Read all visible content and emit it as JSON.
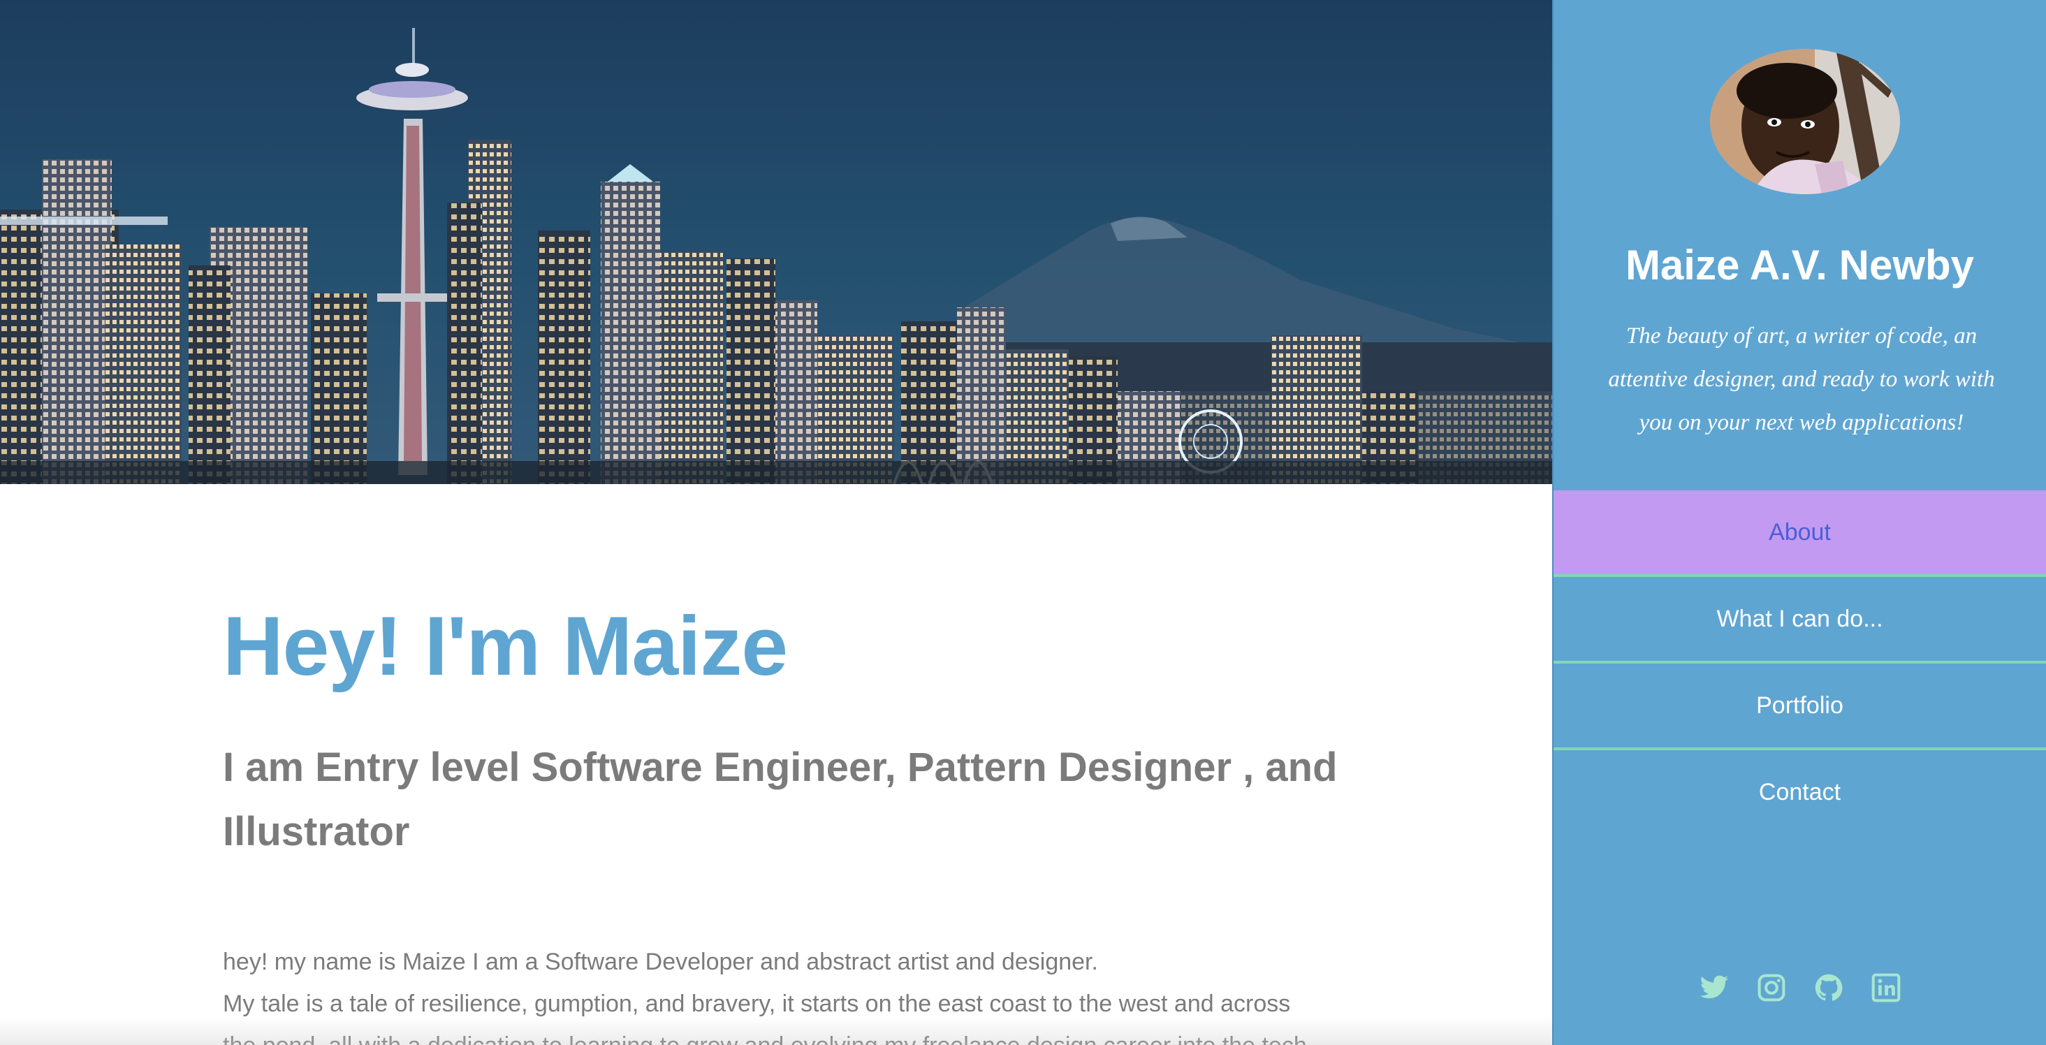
{
  "hero": {
    "image_alt": "Seattle skyline at night"
  },
  "main": {
    "headline": "Hey! I'm Maize",
    "subheadline": "I am Entry level Software Engineer, Pattern Designer , and Illustrator",
    "bio_lines": [
      "hey! my name is Maize I am a Software Developer and abstract artist and designer.",
      "My tale is a tale of resilience, gumption, and bravery, it starts on the east coast to the west and across the pond, all with a dedication to learning to grow and evolving my freelance design career into the tech"
    ]
  },
  "sidebar": {
    "name": "Maize A.V. Newby",
    "tagline": "The beauty of art, a writer of code, an attentive designer, and ready to work with you on your next web applications!",
    "nav": [
      {
        "label": "About",
        "active": true
      },
      {
        "label": "What I can do...",
        "active": false
      },
      {
        "label": "Portfolio",
        "active": false
      },
      {
        "label": "Contact",
        "active": false
      }
    ],
    "social_icons": [
      "twitter-icon",
      "instagram-icon",
      "github-icon",
      "linkedin-icon"
    ]
  },
  "colors": {
    "sidebar_bg": "#5fa5d2",
    "headline": "#5fa5d2",
    "body_text": "#7b7b7b",
    "nav_active_bg": "#c39af2",
    "nav_active_text": "#4a5fd6",
    "nav_divider": "#7fd8b6",
    "social_icon": "#a8e6cf"
  }
}
